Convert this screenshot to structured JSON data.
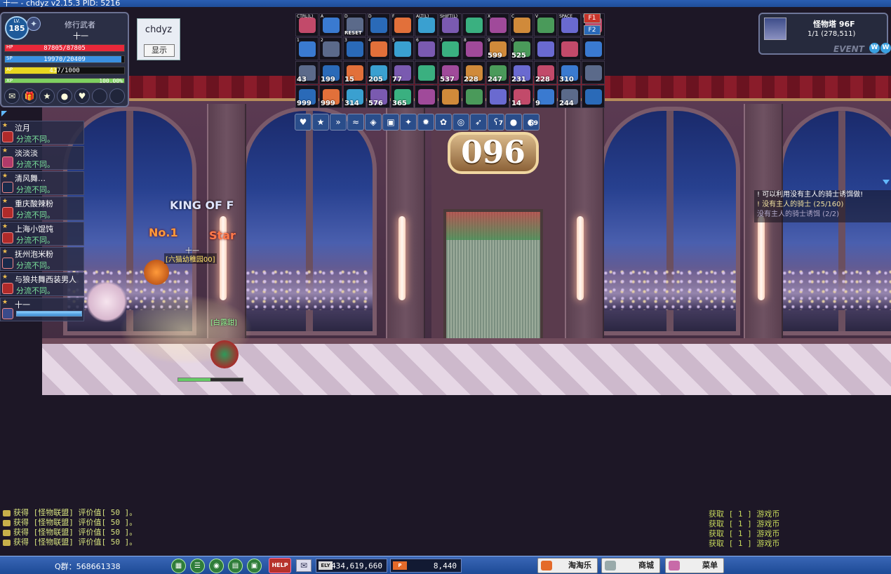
{
  "window": {
    "title": "十一 - chdyz v2.15.3     PID: 5216"
  },
  "player": {
    "level_tag": "LV.",
    "level": "185",
    "job": "修行武者",
    "name": "十一",
    "hp": {
      "label": "HP",
      "text": "87805/87805",
      "fraction": 1.0,
      "color": "#e8283a"
    },
    "mp": {
      "label": "SP",
      "text": "19970/20409",
      "fraction": 0.978,
      "color": "#3a8fe0"
    },
    "ap": {
      "label": "AP",
      "text": "437/1000",
      "fraction": 0.437,
      "color": "#e8d620"
    },
    "xp": {
      "label": "XP",
      "text": "100.00%",
      "fraction": 1.0,
      "color": "#7ed060"
    },
    "quickbar": [
      "envelope-icon",
      "gift-icon",
      "star-icon",
      "cookie-icon",
      "heart-icon"
    ]
  },
  "client_box": {
    "name": "chdyz",
    "button": "显示"
  },
  "skill_slots": [
    {
      "key": "CTRL(L)",
      "count": ""
    },
    {
      "key": "A",
      "count": ""
    },
    {
      "key": "D",
      "count": ""
    },
    {
      "key": "D",
      "count": ""
    },
    {
      "key": "F",
      "count": ""
    },
    {
      "key": "ALT(L)",
      "count": ""
    },
    {
      "key": "SHIFT(L)",
      "count": ""
    },
    {
      "key": "",
      "count": ""
    },
    {
      "key": "X",
      "count": ""
    },
    {
      "key": "C",
      "count": ""
    },
    {
      "key": "V",
      "count": ""
    },
    {
      "key": "SPACE",
      "count": ""
    },
    {
      "key": "F1",
      "count": ""
    },
    {
      "key": "1",
      "count": ""
    },
    {
      "key": "2",
      "count": ""
    },
    {
      "key": "3",
      "count": ""
    },
    {
      "key": "4",
      "count": ""
    },
    {
      "key": "5",
      "count": ""
    },
    {
      "key": "6",
      "count": ""
    },
    {
      "key": "7",
      "count": ""
    },
    {
      "key": "8",
      "count": ""
    },
    {
      "key": "9",
      "count": "599"
    },
    {
      "key": "0",
      "count": "525"
    },
    {
      "key": "",
      "count": ""
    },
    {
      "key": "",
      "count": ""
    },
    {
      "key": "",
      "count": ""
    },
    {
      "key": "",
      "count": "43"
    },
    {
      "key": "",
      "count": "199"
    },
    {
      "key": "",
      "count": "15"
    },
    {
      "key": "",
      "count": "205"
    },
    {
      "key": "",
      "count": "77"
    },
    {
      "key": "",
      "count": ""
    },
    {
      "key": "",
      "count": "537"
    },
    {
      "key": "",
      "count": "228"
    },
    {
      "key": "",
      "count": "247"
    },
    {
      "key": "",
      "count": "231"
    },
    {
      "key": "",
      "count": "228"
    },
    {
      "key": "",
      "count": "310"
    },
    {
      "key": "",
      "count": ""
    },
    {
      "key": "",
      "count": "999"
    },
    {
      "key": "",
      "count": "999"
    },
    {
      "key": "",
      "count": "314"
    },
    {
      "key": "",
      "count": "576"
    },
    {
      "key": "",
      "count": "365"
    },
    {
      "key": "",
      "count": ""
    },
    {
      "key": "",
      "count": ""
    },
    {
      "key": "",
      "count": ""
    },
    {
      "key": "",
      "count": ""
    },
    {
      "key": "",
      "count": "14"
    },
    {
      "key": "",
      "count": "9"
    },
    {
      "key": "",
      "count": "244"
    },
    {
      "key": "",
      "count": ""
    }
  ],
  "fkeys": [
    "F1",
    "F2"
  ],
  "reset_label": "RESET",
  "buffs": [
    {
      "icon": "heart-icon",
      "count": ""
    },
    {
      "icon": "star-icon",
      "count": ""
    },
    {
      "icon": "dash-icon",
      "count": ""
    },
    {
      "icon": "wave-icon",
      "count": ""
    },
    {
      "icon": "shield-icon",
      "count": ""
    },
    {
      "icon": "armor-icon",
      "count": ""
    },
    {
      "icon": "sparkle-icon",
      "count": ""
    },
    {
      "icon": "flame-icon",
      "count": ""
    },
    {
      "icon": "paw-icon",
      "count": ""
    },
    {
      "icon": "helmet-icon",
      "count": ""
    },
    {
      "icon": "wing-icon",
      "count": ""
    },
    {
      "icon": "bear-icon",
      "count": "7"
    },
    {
      "icon": "orb-icon",
      "count": ""
    },
    {
      "icon": "sushi-icon",
      "count": "59"
    }
  ],
  "map": {
    "title": "怪物塔 96F",
    "sub": "1/1 (278,511)",
    "event": "EVENT",
    "floor_sign": "096"
  },
  "quest": {
    "line1": "! 可以利用没有主人的骑士诱饵做!",
    "line2": "! 没有主人的骑士 (25/160)",
    "line3": "没有主人的骑士诱饵 (2/2)"
  },
  "party": [
    {
      "name": "泣月",
      "status": "分流不同。"
    },
    {
      "name": "淡淡淡",
      "status": "分流不同。"
    },
    {
      "name": "清风舞…",
      "status": "分流不同。"
    },
    {
      "name": "重庆酸辣粉",
      "status": "分流不同。"
    },
    {
      "name": "上海小馄饨",
      "status": "分流不同。"
    },
    {
      "name": "抚州泡米粉",
      "status": "分流不同。"
    },
    {
      "name": "与狼共舞西装男人",
      "status": "分流不同。"
    },
    {
      "name": "十一",
      "status": "",
      "hp_fraction": 1.0
    }
  ],
  "character": {
    "name": "十一",
    "guild": "[六猫幼稚园00]",
    "pet": "[白露甜]",
    "king": "KING OF F",
    "no1": "No.1",
    "star": "Star"
  },
  "chat_left": [
    "获得 [怪物联盟] 评价值[ 50 ]。",
    "获得 [怪物联盟] 评价值[ 50 ]。",
    "获得 [怪物联盟] 评价值[ 50 ]。",
    "获得 [怪物联盟] 评价值[ 50 ]。"
  ],
  "chat_right": [
    "获取 [ 1 ] 游戏币",
    "获取 [ 1 ] 游戏币",
    "获取 [ 1 ] 游戏币",
    "获取 [ 1 ] 游戏币"
  ],
  "bottom": {
    "qq": "Q群：568661338",
    "help": "HELP",
    "ely_tag": "ELY",
    "ely": "434,619,660",
    "p_tag": "P",
    "points": "8,440",
    "shop1": "淘淘乐",
    "shop2": "商城",
    "shop3": "菜单"
  }
}
